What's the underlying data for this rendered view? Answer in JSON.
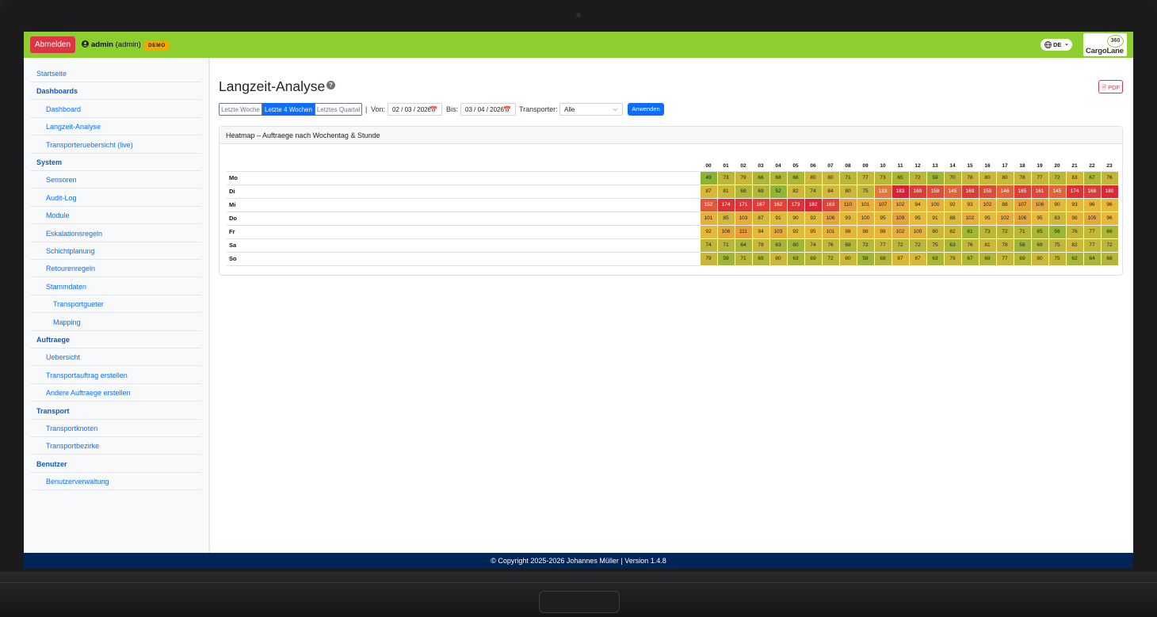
{
  "topbar": {
    "logout_label": "Abmelden",
    "user_name": "admin",
    "user_role": "(admin)",
    "demo_badge": "DEMO",
    "lang": "DE",
    "logo_text": "CargoLane",
    "logo_badge": "360"
  },
  "sidebar": {
    "items": [
      {
        "label": "Startseite",
        "type": "link",
        "indent": 0
      },
      {
        "label": "Dashboards",
        "type": "head",
        "indent": 0
      },
      {
        "label": "Dashboard",
        "type": "link",
        "indent": 1
      },
      {
        "label": "Langzeit-Analyse",
        "type": "link",
        "indent": 1
      },
      {
        "label": "Transporteruebersicht (live)",
        "type": "link",
        "indent": 1
      },
      {
        "label": "System",
        "type": "head",
        "indent": 0
      },
      {
        "label": "Sensoren",
        "type": "link",
        "indent": 1
      },
      {
        "label": "Audit-Log",
        "type": "link",
        "indent": 1
      },
      {
        "label": "Module",
        "type": "link",
        "indent": 1
      },
      {
        "label": "Eskalationsregeln",
        "type": "link",
        "indent": 1
      },
      {
        "label": "Schichtplanung",
        "type": "link",
        "indent": 1
      },
      {
        "label": "Retourenregeln",
        "type": "link",
        "indent": 1
      },
      {
        "label": "Stammdaten",
        "type": "link",
        "indent": 1
      },
      {
        "label": "Transportgueter",
        "type": "link",
        "indent": 2
      },
      {
        "label": "Mapping",
        "type": "link",
        "indent": 2
      },
      {
        "label": "Auftraege",
        "type": "head",
        "indent": 0
      },
      {
        "label": "Uebersicht",
        "type": "link",
        "indent": 1
      },
      {
        "label": "Transportauftrag erstellen",
        "type": "link",
        "indent": 1
      },
      {
        "label": "Andere Auftraege erstellen",
        "type": "link",
        "indent": 1
      },
      {
        "label": "Transport",
        "type": "head",
        "indent": 0
      },
      {
        "label": "Transportknoten",
        "type": "link",
        "indent": 1
      },
      {
        "label": "Transportbezirke",
        "type": "link",
        "indent": 1
      },
      {
        "label": "Benutzer",
        "type": "head",
        "indent": 0
      },
      {
        "label": "Benutzerverwaltung",
        "type": "link",
        "indent": 1
      }
    ]
  },
  "main": {
    "title": "Langzeit-Analyse",
    "help_icon": "?",
    "pdf_label": "PDF",
    "filters": {
      "ranges": [
        "Letzte Woche",
        "Letzte 4 Wochen",
        "Letztes Quartal"
      ],
      "active_range": "Letzte 4 Wochen",
      "separator": "|",
      "from_label": "Von:",
      "from_value": "02 / 03 / 2026",
      "to_label": "Bis:",
      "to_value": "03 / 04 / 2026",
      "transporter_label": "Transporter:",
      "transporter_value": "Alle",
      "apply_label": "Anwenden"
    },
    "card_title": "Heatmap – Auftraege nach Wochentag & Stunde"
  },
  "chart_data": {
    "type": "heatmap",
    "x": [
      "00",
      "01",
      "02",
      "03",
      "04",
      "05",
      "06",
      "07",
      "08",
      "09",
      "10",
      "11",
      "12",
      "13",
      "14",
      "15",
      "16",
      "17",
      "18",
      "19",
      "20",
      "21",
      "22",
      "23"
    ],
    "y": [
      "Mo",
      "Di",
      "Mi",
      "Do",
      "Fr",
      "Sa",
      "So"
    ],
    "values": [
      [
        49,
        73,
        79,
        66,
        68,
        66,
        80,
        80,
        71,
        77,
        73,
        65,
        72,
        59,
        70,
        78,
        80,
        80,
        78,
        77,
        72,
        83,
        67,
        76
      ],
      [
        87,
        81,
        68,
        69,
        52,
        82,
        74,
        84,
        80,
        75,
        133,
        183,
        169,
        158,
        145,
        169,
        159,
        146,
        165,
        161,
        145,
        174,
        168,
        180
      ],
      [
        152,
        174,
        171,
        167,
        162,
        173,
        182,
        163,
        110,
        101,
        107,
        102,
        94,
        100,
        92,
        93,
        102,
        88,
        107,
        106,
        90,
        93,
        96,
        96
      ],
      [
        101,
        85,
        103,
        87,
        91,
        90,
        92,
        106,
        93,
        100,
        95,
        109,
        95,
        91,
        88,
        102,
        95,
        102,
        106,
        95,
        83,
        98,
        105,
        96
      ],
      [
        92,
        106,
        111,
        94,
        103,
        92,
        95,
        101,
        98,
        98,
        98,
        102,
        100,
        80,
        82,
        61,
        73,
        72,
        71,
        65,
        56,
        76,
        77,
        66
      ],
      [
        74,
        71,
        64,
        79,
        63,
        60,
        74,
        76,
        68,
        72,
        77,
        72,
        72,
        75,
        63,
        76,
        81,
        78,
        58,
        69,
        75,
        82,
        77,
        72
      ],
      [
        79,
        59,
        71,
        69,
        80,
        63,
        69,
        72,
        80,
        58,
        68,
        87,
        87,
        63,
        79,
        67,
        68,
        77,
        69,
        80,
        75,
        62,
        64,
        68
      ]
    ],
    "colors": {
      "low": "#84b434",
      "mid": "#e9b93a",
      "high": "#dc1e35"
    }
  },
  "footer": {
    "text": "© Copyright 2025-2026 Johannes Müller | Version 1.4.8"
  }
}
